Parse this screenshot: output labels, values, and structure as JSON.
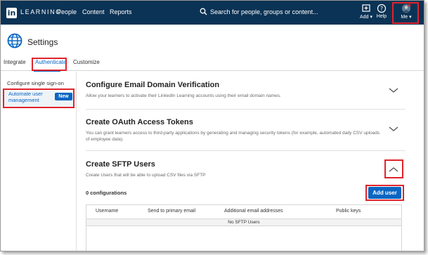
{
  "topnav": {
    "logo": "in",
    "brand": "LEARNING",
    "links": [
      "People",
      "Content",
      "Reports"
    ],
    "search_placeholder": "Search for people, groups or content...",
    "add_label": "Add",
    "help_label": "Help",
    "me_label": "Me"
  },
  "header": {
    "title": "Settings"
  },
  "tabs": [
    "Integrate",
    "Authenticate",
    "Customize"
  ],
  "sidebar": {
    "items": [
      "Configure single sign-on",
      "Automate user management"
    ],
    "badge": "New"
  },
  "sections": [
    {
      "title": "Configure Email Domain Verification",
      "description": "Allow your learners to activate their LinkedIn Learning accounts using their email domain names."
    },
    {
      "title": "Create OAuth Access Tokens",
      "description": "You can grant learners access to third-party applications by generating and managing security tokens (for example, automated daily CSV uploads of employee data)."
    },
    {
      "title": "Create SFTP Users",
      "description": "Create Users that will be able to upload CSV files via SFTP"
    }
  ],
  "sftp": {
    "count_label": "0 configurations",
    "add_button": "Add user",
    "columns": [
      "Username",
      "Send to primary email",
      "Additional email addresses",
      "Public keys"
    ],
    "empty_text": "No SFTP Users"
  },
  "colors": {
    "nav_bg": "#0b3355",
    "accent": "#0a66c2",
    "highlight": "#e0232b"
  }
}
